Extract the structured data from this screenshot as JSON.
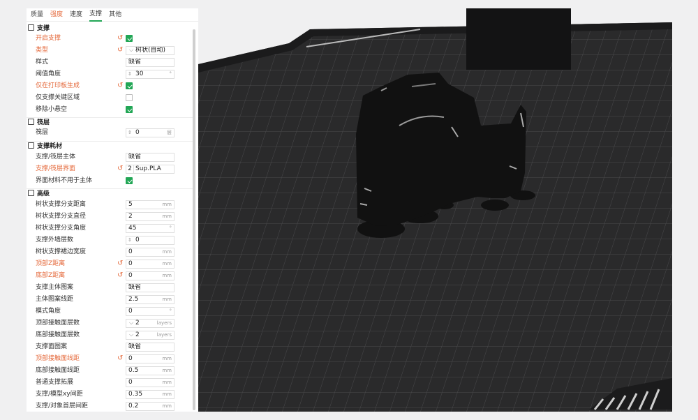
{
  "tabs": [
    {
      "label": "质量",
      "state": "normal"
    },
    {
      "label": "强度",
      "state": "warn"
    },
    {
      "label": "速度",
      "state": "normal"
    },
    {
      "label": "支撑",
      "state": "active"
    },
    {
      "label": "其他",
      "state": "normal"
    }
  ],
  "sections": {
    "support": "支撑",
    "raft": "筏层",
    "filament": "支撑耗材",
    "advanced": "高级"
  },
  "rows": {
    "enable": {
      "label": "开启支撑",
      "checked": true
    },
    "type": {
      "label": "类型",
      "value": "树状(自动)"
    },
    "style": {
      "label": "样式",
      "value": "缺省"
    },
    "threshold": {
      "label": "阈值角度",
      "value": "30",
      "unit": "°"
    },
    "on_build_plate": {
      "label": "仅在打印板生成",
      "checked": true
    },
    "critical_only": {
      "label": "仅支撑关键区域",
      "checked": false
    },
    "remove_small": {
      "label": "移除小悬空",
      "checked": true
    },
    "raft_layers": {
      "label": "筏层",
      "value": "0",
      "unit": "层"
    },
    "base_filament": {
      "label": "支撑/筏层主体",
      "value": "缺省"
    },
    "interface_filament": {
      "label": "支撑/筏层界面",
      "index": "2",
      "value": "Sup.PLA"
    },
    "no_interface_body": {
      "label": "界面材料不用于主体",
      "checked": true
    },
    "branch_distance": {
      "label": "树状支撑分支距离",
      "value": "5",
      "unit": "mm"
    },
    "branch_diameter": {
      "label": "树状支撑分支直径",
      "value": "2",
      "unit": "mm"
    },
    "branch_angle": {
      "label": "树状支撑分支角度",
      "value": "45",
      "unit": "°"
    },
    "wall_count": {
      "label": "支撑外墙层数",
      "value": "0"
    },
    "brim_width": {
      "label": "树状支撑裙边宽度",
      "value": "0",
      "unit": "mm"
    },
    "top_z": {
      "label": "顶部Z距离",
      "value": "0",
      "unit": "mm"
    },
    "bottom_z": {
      "label": "底部Z距离",
      "value": "0",
      "unit": "mm"
    },
    "base_pattern": {
      "label": "支撑主体图案",
      "value": "缺省"
    },
    "base_spacing": {
      "label": "主体图案线距",
      "value": "2.5",
      "unit": "mm"
    },
    "pattern_angle": {
      "label": "模式角度",
      "value": "0",
      "unit": "°"
    },
    "top_interface_layers": {
      "label": "顶部接触面层数",
      "value": "2",
      "unit": "layers"
    },
    "bottom_interface_layers": {
      "label": "底部接触面层数",
      "value": "2",
      "unit": "layers"
    },
    "interface_pattern": {
      "label": "支撑面图案",
      "value": "缺省"
    },
    "top_interface_spacing": {
      "label": "顶部接触面线距",
      "value": "0",
      "unit": "mm"
    },
    "bottom_interface_spacing": {
      "label": "底部接触面线距",
      "value": "0.5",
      "unit": "mm"
    },
    "expansion": {
      "label": "普通支撑拓展",
      "value": "0",
      "unit": "mm"
    },
    "xy_distance": {
      "label": "支撑/模型xy间距",
      "value": "0.35",
      "unit": "mm"
    },
    "first_layer_gap": {
      "label": "支撑/对象首层间距",
      "value": "0.2",
      "unit": "mm"
    }
  },
  "colors": {
    "accent": "#21a655",
    "modified": "#e4683a",
    "bed": "#2a2a2b",
    "grid": "#4a4a4c",
    "model": "#111111"
  }
}
